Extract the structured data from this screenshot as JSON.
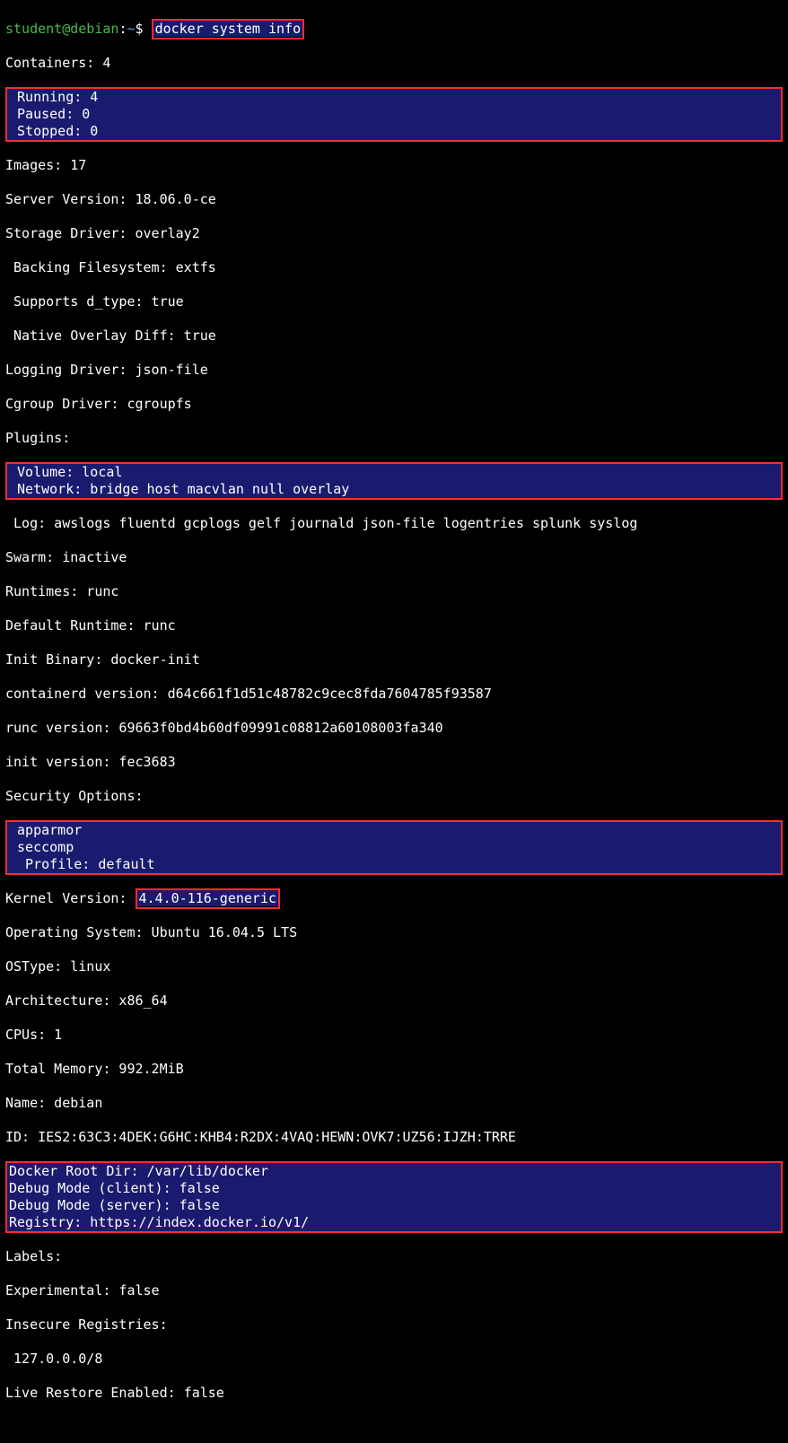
{
  "prompt": {
    "user": "student@debian",
    "sep": ":",
    "cwd": "~",
    "sym": "$",
    "command": "docker system info"
  },
  "containers_header": "Containers: 4",
  "containers_box": {
    "running": " Running: 4 ",
    "paused": " Paused: 0  ",
    "stopped": " Stopped: 0 "
  },
  "lines1": [
    "Images: 17",
    "Server Version: 18.06.0-ce",
    "Storage Driver: overlay2",
    " Backing Filesystem: extfs",
    " Supports d_type: true",
    " Native Overlay Diff: true",
    "Logging Driver: json-file",
    "Cgroup Driver: cgroupfs",
    "Plugins:"
  ],
  "plugins_box": {
    "volume": " Volume: local                              ",
    "network": " Network: bridge host macvlan null overlay  "
  },
  "lines2": [
    " Log: awslogs fluentd gcplogs gelf journald json-file logentries splunk syslog",
    "Swarm: inactive",
    "Runtimes: runc",
    "Default Runtime: runc",
    "Init Binary: docker-init",
    "containerd version: d64c661f1d51c48782c9cec8fda7604785f93587",
    "runc version: 69663f0bd4b60df09991c08812a60108003fa340",
    "init version: fec3683",
    "Security Options:"
  ],
  "security_box": {
    "apparmor": " apparmor           ",
    "seccomp": " seccomp            ",
    "profile": "  Profile: default  "
  },
  "kernel_label": "Kernel Version: ",
  "kernel_value": "4.4.0-116-generic",
  "lines3": [
    "Operating System: Ubuntu 16.04.5 LTS",
    "OSType: linux",
    "Architecture: x86_64",
    "CPUs: 1",
    "Total Memory: 992.2MiB",
    "Name: debian",
    "ID: IES2:63C3:4DEK:G6HC:KHB4:R2DX:4VAQ:HEWN:OVK7:UZ56:IJZH:TRRE"
  ],
  "root_box": {
    "rootdir": "Docker Root Dir: /var/lib/docker        ",
    "debugc": "Debug Mode (client): false              ",
    "debugs": "Debug Mode (server): false              ",
    "registry": "Registry: https://index.docker.io/v1/   "
  },
  "lines4": [
    "Labels:",
    "Experimental: false",
    "Insecure Registries:",
    " 127.0.0.0/8",
    "Live Restore Enabled: false",
    ""
  ]
}
